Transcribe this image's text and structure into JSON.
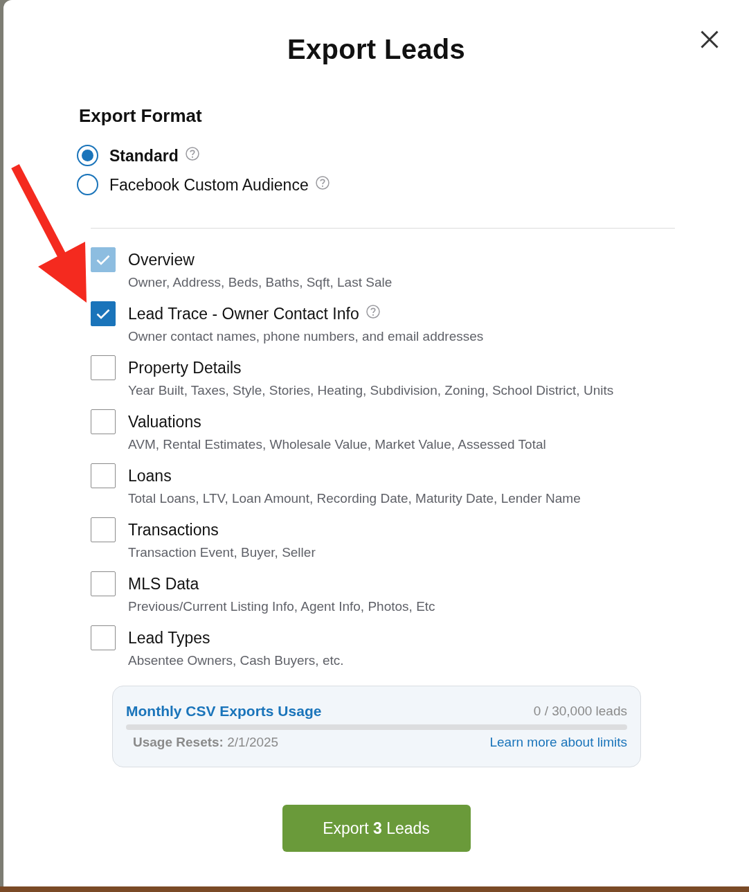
{
  "dialog": {
    "title": "Export Leads"
  },
  "export_format": {
    "heading": "Export Format",
    "options": [
      {
        "label": "Standard",
        "selected": true,
        "help": true
      },
      {
        "label": "Facebook Custom Audience",
        "selected": false,
        "help": true
      }
    ]
  },
  "sections": [
    {
      "label": "Overview",
      "description": "Owner, Address, Beds, Baths, Sqft, Last Sale",
      "checked": true,
      "disabled": true,
      "help": false
    },
    {
      "label": "Lead Trace - Owner Contact Info",
      "description": "Owner contact names, phone numbers, and email addresses",
      "checked": true,
      "disabled": false,
      "help": true
    },
    {
      "label": "Property Details",
      "description": "Year Built, Taxes, Style, Stories, Heating, Subdivision, Zoning, School District, Units",
      "checked": false,
      "disabled": false,
      "help": false
    },
    {
      "label": "Valuations",
      "description": "AVM, Rental Estimates, Wholesale Value, Market Value, Assessed Total",
      "checked": false,
      "disabled": false,
      "help": false
    },
    {
      "label": "Loans",
      "description": "Total Loans, LTV, Loan Amount, Recording Date, Maturity Date, Lender Name",
      "checked": false,
      "disabled": false,
      "help": false
    },
    {
      "label": "Transactions",
      "description": "Transaction Event, Buyer, Seller",
      "checked": false,
      "disabled": false,
      "help": false
    },
    {
      "label": "MLS Data",
      "description": "Previous/Current Listing Info, Agent Info, Photos, Etc",
      "checked": false,
      "disabled": false,
      "help": false
    },
    {
      "label": "Lead Types",
      "description": "Absentee Owners, Cash Buyers, etc.",
      "checked": false,
      "disabled": false,
      "help": false
    }
  ],
  "usage": {
    "title": "Monthly CSV Exports Usage",
    "count": "0 / 30,000 leads",
    "reset": "**Usage Resets:** 2/1/2025",
    "link": "Learn more about limits"
  },
  "export_button": {
    "label": "Export **3** Leads"
  }
}
